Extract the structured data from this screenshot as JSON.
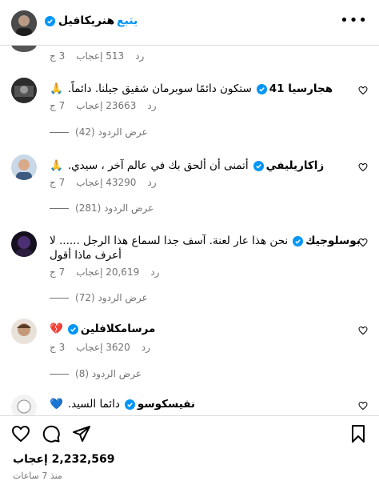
{
  "header": {
    "username": "هنريكافيل",
    "follow_label": "يتبع",
    "dot": "•"
  },
  "comments": [
    {
      "id": "c0",
      "likes": "513 إعجاب",
      "age": "3 ج",
      "reply_label": "رد"
    },
    {
      "id": "c1",
      "username": "هجارسيا 41",
      "text": "ستكون دائمًا سوبرمان شقيق جيلنا. دائماً.",
      "emoji": "🙏",
      "age": "7 ج",
      "likes": "23663 إعجاب",
      "reply_label": "رد",
      "view_replies": "عرض الردود (42)"
    },
    {
      "id": "c2",
      "username": "زاكاريليفي",
      "text": "أتمنى أن ألحق بك في عالم آخر ، سيدي.",
      "emoji": "🙏",
      "age": "7 ج",
      "likes": "43290 إعجاب",
      "reply_label": "رد",
      "view_replies": "عرض الردود (281)"
    },
    {
      "id": "c3",
      "username": "بوسلوجيك",
      "text_line1": "نحن هذا عار لعنة. آسف جدا لسماع هذا الرجل ...... لا",
      "text_line2": "أعرف ماذا أقول",
      "age": "7 ج",
      "likes": "20,619 إعجاب",
      "reply_label": "رد",
      "view_replies": "عرض الردود (72)"
    },
    {
      "id": "c4",
      "username": "مرسامكلافلين",
      "emoji": "💔",
      "age": "3 ج",
      "likes": "3620 إعجاب",
      "reply_label": "رد",
      "view_replies": "عرض الردود (8)"
    },
    {
      "id": "c5",
      "username": "نفيسكوسو",
      "text": "دائما السيد.",
      "emoji": "💙"
    }
  ],
  "footer": {
    "likes": "2,232,569 إعجاب",
    "time": "منذ 7 ساعات"
  },
  "icons": {
    "verified": "verified-badge-icon",
    "accent": "#0095f6",
    "heart_red": "#ed4956"
  }
}
